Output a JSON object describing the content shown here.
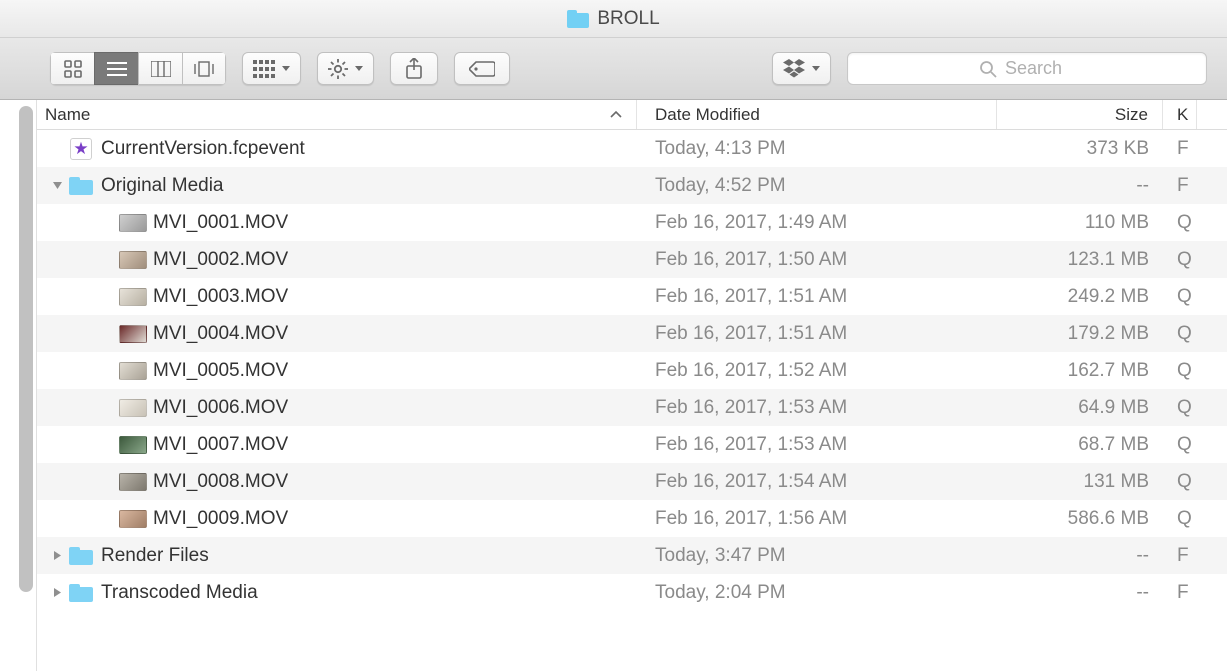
{
  "window": {
    "title": "BROLL"
  },
  "search": {
    "placeholder": "Search"
  },
  "columns": {
    "name": "Name",
    "date": "Date Modified",
    "size": "Size",
    "kind": "K"
  },
  "rows": [
    {
      "indent": 1,
      "disclosure": "",
      "icon": "fcp",
      "name": "CurrentVersion.fcpevent",
      "date": "Today, 4:13 PM",
      "size": "373 KB",
      "kind": "F",
      "dim": false
    },
    {
      "indent": 1,
      "disclosure": "down",
      "icon": "folder",
      "name": "Original Media",
      "date": "Today, 4:52 PM",
      "size": "--",
      "kind": "F",
      "dim": true
    },
    {
      "indent": 2,
      "disclosure": "",
      "icon": "video",
      "name": "MVI_0001.MOV",
      "date": "Feb 16, 2017, 1:49 AM",
      "size": "110 MB",
      "kind": "Q",
      "dim": false,
      "thumb": [
        "#cfcfcf",
        "#9a9a9a"
      ]
    },
    {
      "indent": 2,
      "disclosure": "",
      "icon": "video",
      "name": "MVI_0002.MOV",
      "date": "Feb 16, 2017, 1:50 AM",
      "size": "123.1 MB",
      "kind": "Q",
      "dim": true,
      "thumb": [
        "#d7c7b6",
        "#a08e7c"
      ]
    },
    {
      "indent": 2,
      "disclosure": "",
      "icon": "video",
      "name": "MVI_0003.MOV",
      "date": "Feb 16, 2017, 1:51 AM",
      "size": "249.2 MB",
      "kind": "Q",
      "dim": false,
      "thumb": [
        "#e7e2d9",
        "#b7b0a2"
      ]
    },
    {
      "indent": 2,
      "disclosure": "",
      "icon": "video",
      "name": "MVI_0004.MOV",
      "date": "Feb 16, 2017, 1:51 AM",
      "size": "179.2 MB",
      "kind": "Q",
      "dim": true,
      "thumb": [
        "#6b2a2a",
        "#e0dcd5"
      ]
    },
    {
      "indent": 2,
      "disclosure": "",
      "icon": "video",
      "name": "MVI_0005.MOV",
      "date": "Feb 16, 2017, 1:52 AM",
      "size": "162.7 MB",
      "kind": "Q",
      "dim": false,
      "thumb": [
        "#e2ddd3",
        "#a9a296"
      ]
    },
    {
      "indent": 2,
      "disclosure": "",
      "icon": "video",
      "name": "MVI_0006.MOV",
      "date": "Feb 16, 2017, 1:53 AM",
      "size": "64.9 MB",
      "kind": "Q",
      "dim": true,
      "thumb": [
        "#f0ece4",
        "#c8c2b6"
      ]
    },
    {
      "indent": 2,
      "disclosure": "",
      "icon": "video",
      "name": "MVI_0007.MOV",
      "date": "Feb 16, 2017, 1:53 AM",
      "size": "68.7 MB",
      "kind": "Q",
      "dim": false,
      "thumb": [
        "#3d5a3d",
        "#8aa78a"
      ]
    },
    {
      "indent": 2,
      "disclosure": "",
      "icon": "video",
      "name": "MVI_0008.MOV",
      "date": "Feb 16, 2017, 1:54 AM",
      "size": "131 MB",
      "kind": "Q",
      "dim": true,
      "thumb": [
        "#b8b3a9",
        "#7d786e"
      ]
    },
    {
      "indent": 2,
      "disclosure": "",
      "icon": "video",
      "name": "MVI_0009.MOV",
      "date": "Feb 16, 2017, 1:56 AM",
      "size": "586.6 MB",
      "kind": "Q",
      "dim": false,
      "thumb": [
        "#d9b7a0",
        "#a07e66"
      ]
    },
    {
      "indent": 1,
      "disclosure": "right",
      "icon": "folder",
      "name": "Render Files",
      "date": "Today, 3:47 PM",
      "size": "--",
      "kind": "F",
      "dim": true
    },
    {
      "indent": 1,
      "disclosure": "right",
      "icon": "folder",
      "name": "Transcoded Media",
      "date": "Today, 2:04 PM",
      "size": "--",
      "kind": "F",
      "dim": false
    }
  ]
}
